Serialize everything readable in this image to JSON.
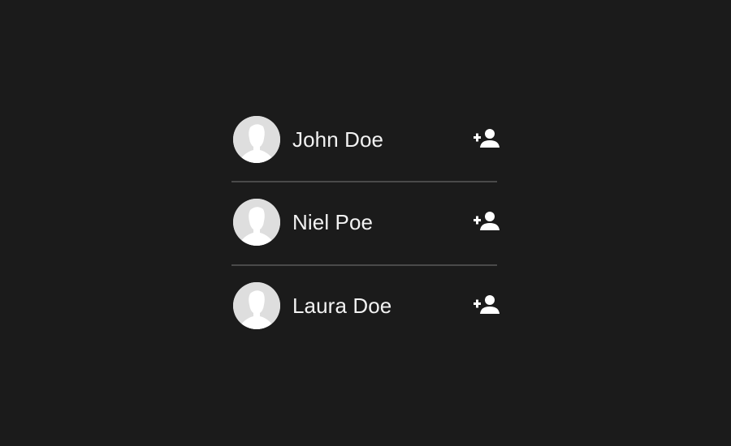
{
  "contacts": [
    {
      "name": "John Doe",
      "action_icon": "add-user-icon"
    },
    {
      "name": "Niel Poe",
      "action_icon": "add-user-icon"
    },
    {
      "name": "Laura Doe",
      "action_icon": "add-user-icon"
    }
  ],
  "colors": {
    "background": "#1b1b1b",
    "text": "#f2f2f2",
    "divider": "#4a4a4a",
    "avatar_bg": "#dedede",
    "avatar_silhouette": "#ffffff"
  }
}
